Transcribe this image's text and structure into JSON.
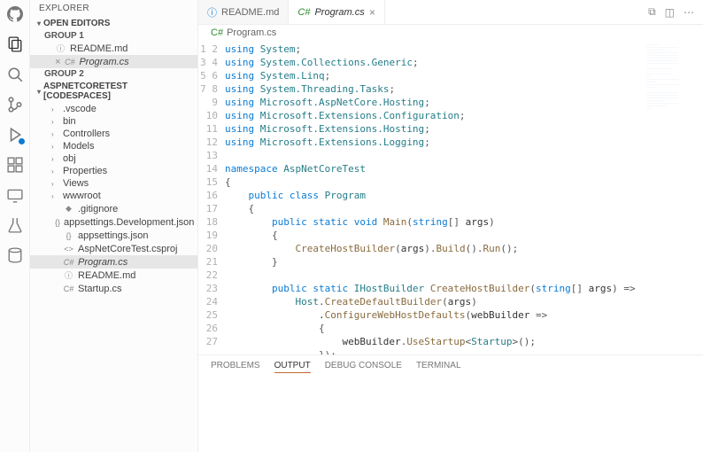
{
  "sidebar": {
    "title": "EXPLORER",
    "openEditors": {
      "label": "OPEN EDITORS",
      "groups": [
        {
          "label": "GROUP 1",
          "items": [
            {
              "icon": "info",
              "name": "README.md",
              "active": false
            },
            {
              "icon": "cs",
              "name": "Program.cs",
              "active": true,
              "closable": true
            }
          ]
        },
        {
          "label": "GROUP 2",
          "items": []
        }
      ]
    },
    "workspace": {
      "label": "ASPNETCORETEST [CODESPACES]",
      "items": [
        {
          "kind": "folder",
          "name": ".vscode"
        },
        {
          "kind": "folder",
          "name": "bin"
        },
        {
          "kind": "folder",
          "name": "Controllers"
        },
        {
          "kind": "folder",
          "name": "Models"
        },
        {
          "kind": "folder",
          "name": "obj"
        },
        {
          "kind": "folder",
          "name": "Properties"
        },
        {
          "kind": "folder",
          "name": "Views"
        },
        {
          "kind": "folder",
          "name": "wwwroot"
        },
        {
          "kind": "file",
          "icon": "git",
          "name": ".gitignore"
        },
        {
          "kind": "file",
          "icon": "json",
          "name": "appsettings.Development.json"
        },
        {
          "kind": "file",
          "icon": "json",
          "name": "appsettings.json"
        },
        {
          "kind": "file",
          "icon": "proj",
          "name": "AspNetCoreTest.csproj"
        },
        {
          "kind": "file",
          "icon": "cs",
          "name": "Program.cs",
          "active": true
        },
        {
          "kind": "file",
          "icon": "info",
          "name": "README.md"
        },
        {
          "kind": "file",
          "icon": "cs",
          "name": "Startup.cs"
        }
      ]
    }
  },
  "tabs": [
    {
      "icon": "info",
      "label": "README.md",
      "active": false
    },
    {
      "icon": "cs",
      "label": "Program.cs",
      "active": true
    }
  ],
  "breadcrumb": {
    "icon": "cs",
    "text": "Program.cs"
  },
  "code": {
    "lines": [
      [
        [
          "kw",
          "using"
        ],
        [
          "",
          " "
        ],
        [
          "ns",
          "System"
        ],
        [
          "op",
          ";"
        ]
      ],
      [
        [
          "kw",
          "using"
        ],
        [
          "",
          " "
        ],
        [
          "ns",
          "System.Collections.Generic"
        ],
        [
          "op",
          ";"
        ]
      ],
      [
        [
          "kw",
          "using"
        ],
        [
          "",
          " "
        ],
        [
          "ns",
          "System.Linq"
        ],
        [
          "op",
          ";"
        ]
      ],
      [
        [
          "kw",
          "using"
        ],
        [
          "",
          " "
        ],
        [
          "ns",
          "System.Threading.Tasks"
        ],
        [
          "op",
          ";"
        ]
      ],
      [
        [
          "kw",
          "using"
        ],
        [
          "",
          " "
        ],
        [
          "ns",
          "Microsoft.AspNetCore.Hosting"
        ],
        [
          "op",
          ";"
        ]
      ],
      [
        [
          "kw",
          "using"
        ],
        [
          "",
          " "
        ],
        [
          "ns",
          "Microsoft.Extensions.Configuration"
        ],
        [
          "op",
          ";"
        ]
      ],
      [
        [
          "kw",
          "using"
        ],
        [
          "",
          " "
        ],
        [
          "ns",
          "Microsoft.Extensions.Hosting"
        ],
        [
          "op",
          ";"
        ]
      ],
      [
        [
          "kw",
          "using"
        ],
        [
          "",
          " "
        ],
        [
          "ns",
          "Microsoft.Extensions.Logging"
        ],
        [
          "op",
          ";"
        ]
      ],
      [],
      [
        [
          "kw",
          "namespace"
        ],
        [
          "",
          " "
        ],
        [
          "ns",
          "AspNetCoreTest"
        ]
      ],
      [
        [
          "op",
          "{"
        ]
      ],
      [
        [
          "",
          "    "
        ],
        [
          "kw",
          "public class"
        ],
        [
          "",
          " "
        ],
        [
          "cls",
          "Program"
        ]
      ],
      [
        [
          "",
          "    "
        ],
        [
          "op",
          "{"
        ]
      ],
      [
        [
          "",
          "        "
        ],
        [
          "kw",
          "public static void"
        ],
        [
          "",
          " "
        ],
        [
          "mth",
          "Main"
        ],
        [
          "op",
          "("
        ],
        [
          "kw",
          "string"
        ],
        [
          "op",
          "[] "
        ],
        [
          "",
          "args"
        ],
        [
          "op",
          ")"
        ]
      ],
      [
        [
          "",
          "        "
        ],
        [
          "op",
          "{"
        ]
      ],
      [
        [
          "",
          "            "
        ],
        [
          "mth",
          "CreateHostBuilder"
        ],
        [
          "op",
          "("
        ],
        [
          "",
          "args"
        ],
        [
          "op",
          ")."
        ],
        [
          "mth",
          "Build"
        ],
        [
          "op",
          "()."
        ],
        [
          "mth",
          "Run"
        ],
        [
          "op",
          "();"
        ]
      ],
      [
        [
          "",
          "        "
        ],
        [
          "op",
          "}"
        ]
      ],
      [],
      [
        [
          "",
          "        "
        ],
        [
          "kw",
          "public static"
        ],
        [
          "",
          " "
        ],
        [
          "cls",
          "IHostBuilder"
        ],
        [
          "",
          " "
        ],
        [
          "mth",
          "CreateHostBuilder"
        ],
        [
          "op",
          "("
        ],
        [
          "kw",
          "string"
        ],
        [
          "op",
          "[] "
        ],
        [
          "",
          "args"
        ],
        [
          "op",
          ") =>"
        ]
      ],
      [
        [
          "",
          "            "
        ],
        [
          "ns",
          "Host"
        ],
        [
          "op",
          "."
        ],
        [
          "mth",
          "CreateDefaultBuilder"
        ],
        [
          "op",
          "("
        ],
        [
          "",
          "args"
        ],
        [
          "op",
          ")"
        ]
      ],
      [
        [
          "",
          "                ."
        ],
        [
          "mth",
          "ConfigureWebHostDefaults"
        ],
        [
          "op",
          "("
        ],
        [
          "",
          "webBuilder"
        ],
        [
          "op",
          " =>"
        ]
      ],
      [
        [
          "",
          "                "
        ],
        [
          "op",
          "{"
        ]
      ],
      [
        [
          "",
          "                    "
        ],
        [
          "",
          "webBuilder"
        ],
        [
          "op",
          "."
        ],
        [
          "mth",
          "UseStartup"
        ],
        [
          "op",
          "<"
        ],
        [
          "cls",
          "Startup"
        ],
        [
          "op",
          ">();"
        ]
      ],
      [
        [
          "",
          "                "
        ],
        [
          "op",
          "});"
        ]
      ],
      [
        [
          "",
          "    "
        ],
        [
          "op",
          "}"
        ]
      ],
      [
        [
          "op",
          "}"
        ]
      ],
      []
    ]
  },
  "panel": {
    "tabs": [
      "PROBLEMS",
      "OUTPUT",
      "DEBUG CONSOLE",
      "TERMINAL"
    ],
    "active": "OUTPUT"
  }
}
